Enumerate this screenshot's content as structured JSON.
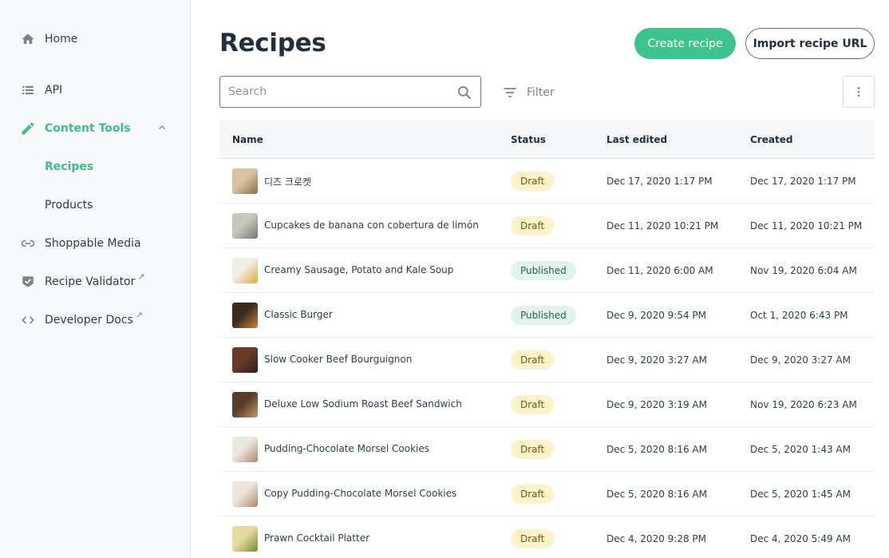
{
  "sidebar": {
    "items": [
      {
        "label": "Home",
        "icon": "home-icon"
      },
      {
        "label": "API",
        "icon": "list-icon"
      },
      {
        "label": "Content Tools",
        "icon": "pencil-icon"
      },
      {
        "label": "Recipes"
      },
      {
        "label": "Products"
      },
      {
        "label": "Shoppable Media",
        "icon": "link-icon"
      },
      {
        "label": "Recipe Validator",
        "icon": "check-badge-icon",
        "external": true
      },
      {
        "label": "Developer Docs",
        "icon": "code-icon",
        "external": true
      }
    ]
  },
  "header": {
    "title": "Recipes",
    "create_label": "Create recipe",
    "import_label": "Import recipe URL"
  },
  "toolbar": {
    "search_placeholder": "Search",
    "filter_label": "Filter"
  },
  "table": {
    "columns": [
      "Name",
      "Status",
      "Last edited",
      "Created"
    ],
    "rows": [
      {
        "name": "디즈 크로켓",
        "status": "Draft",
        "edited": "Dec 17, 2020 1:17 PM",
        "created": "Dec 17, 2020 1:17 PM"
      },
      {
        "name": "Cupcakes de banana con cobertura de limón",
        "status": "Draft",
        "edited": "Dec 11, 2020 10:21 PM",
        "created": "Dec 11, 2020 10:21 PM"
      },
      {
        "name": "Creamy Sausage, Potato and Kale Soup",
        "status": "Published",
        "edited": "Dec 11, 2020 6:00 AM",
        "created": "Nov 19, 2020 6:04 AM"
      },
      {
        "name": "Classic Burger",
        "status": "Published",
        "edited": "Dec 9, 2020 9:54 PM",
        "created": "Oct 1, 2020 6:43 PM"
      },
      {
        "name": "Slow Cooker Beef Bourguignon",
        "status": "Draft",
        "edited": "Dec 9, 2020 3:27 AM",
        "created": "Dec 9, 2020 3:27 AM"
      },
      {
        "name": "Deluxe Low Sodium Roast Beef Sandwich",
        "status": "Draft",
        "edited": "Dec 9, 2020 3:19 AM",
        "created": "Nov 19, 2020 6:23 AM"
      },
      {
        "name": "Pudding-Chocolate Morsel Cookies",
        "status": "Draft",
        "edited": "Dec 5, 2020 8:16 AM",
        "created": "Dec 5, 2020 1:43 AM"
      },
      {
        "name": "Copy Pudding-Chocolate Morsel Cookies",
        "status": "Draft",
        "edited": "Dec 5, 2020 8:16 AM",
        "created": "Dec 5, 2020 1:45 AM"
      },
      {
        "name": "Prawn Cocktail Platter",
        "status": "Draft",
        "edited": "Dec 4, 2020 9:28 PM",
        "created": "Dec 4, 2020 5:49 AM"
      }
    ]
  },
  "colors": {
    "accent": "#3fc38e",
    "draft_badge": "#fdf2c8",
    "published_badge": "#dff4ec"
  }
}
